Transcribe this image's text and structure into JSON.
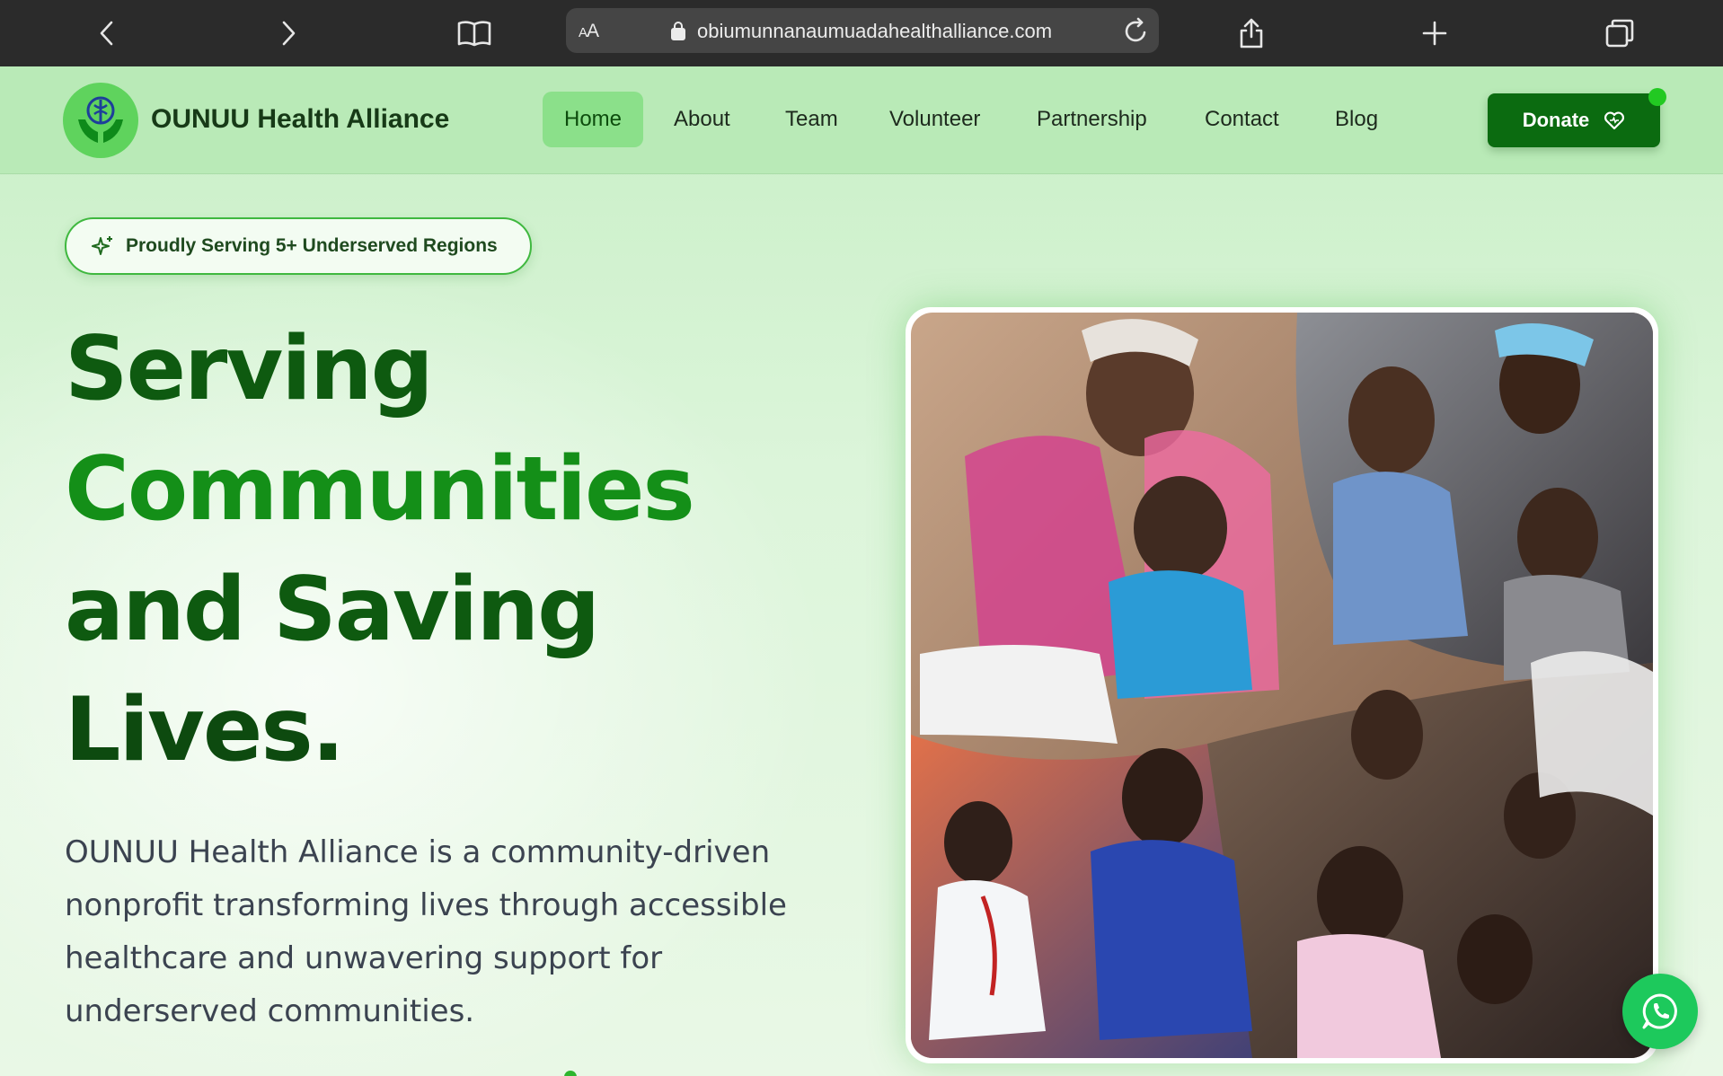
{
  "browser": {
    "text_size_label": "AA",
    "url": "obiumunnanaumuadahealthalliance.com",
    "icons": [
      "back-icon",
      "forward-icon",
      "bookmarks-icon",
      "lock-icon",
      "reload-icon",
      "share-icon",
      "new-tab-icon",
      "tabs-icon"
    ]
  },
  "nav": {
    "brand": "OUNUU Health Alliance",
    "items": [
      {
        "label": "Home",
        "active": true
      },
      {
        "label": "About"
      },
      {
        "label": "Team"
      },
      {
        "label": "Volunteer"
      },
      {
        "label": "Partnership"
      },
      {
        "label": "Contact"
      },
      {
        "label": "Blog"
      }
    ],
    "donate_label": "Donate"
  },
  "hero": {
    "badge": "Proudly Serving 5+ Underserved Regions",
    "headline": [
      "Serving",
      "Communities",
      "and Saving",
      "Lives."
    ],
    "description": "OUNUU Health Alliance is a community-driven nonprofit transforming lives through accessible healthcare and unwavering support for underserved communities."
  },
  "colors": {
    "primary_dark": "#0e5a10",
    "primary": "#148f18",
    "donate_bg": "#0b6b10",
    "nav_bg": "#b9eab7",
    "active_tab": "#8be08a",
    "whatsapp": "#1dc95c"
  }
}
